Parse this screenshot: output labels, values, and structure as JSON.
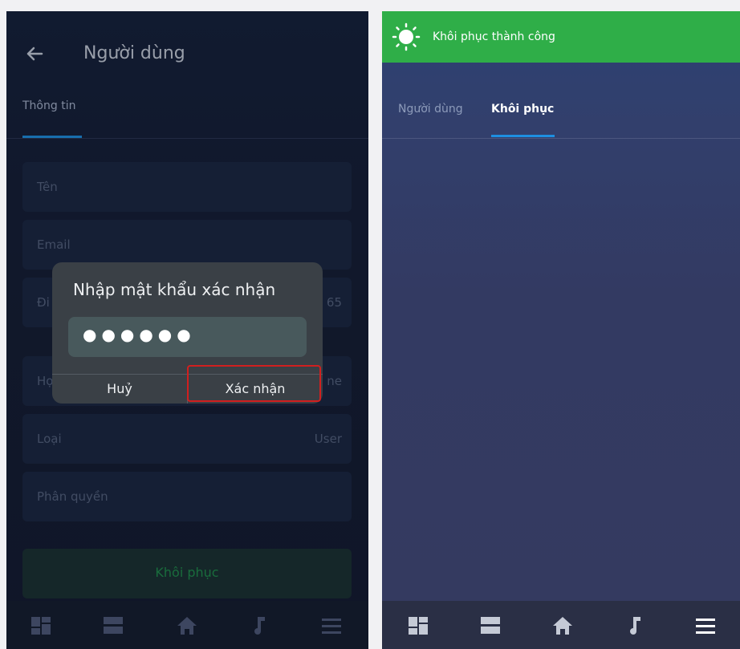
{
  "left": {
    "header_title": "Người dùng",
    "tab_info": "Thông tin",
    "fields": [
      {
        "label": "Tên",
        "value": ""
      },
      {
        "label": "Email",
        "value": ""
      },
      {
        "label": "Đi",
        "value": "65"
      },
      {
        "label": "Họ",
        "value": "ne"
      },
      {
        "label": "Loại",
        "value": "User"
      },
      {
        "label": "Phân quyền",
        "value": ""
      }
    ],
    "restore_button": "Khôi phục"
  },
  "dialog": {
    "title": "Nhập mật khẩu xác nhận",
    "password_value": "●●●●●●",
    "cancel_label": "Huỷ",
    "confirm_label": "Xác nhận"
  },
  "right": {
    "toast_text": "Khôi phục thành công",
    "tab_user": "Người dùng",
    "tab_restore": "Khôi phục"
  },
  "nav": {
    "icons": [
      "dashboard-icon",
      "list-icon",
      "home-icon",
      "music-icon",
      "menu-icon"
    ]
  },
  "colors": {
    "accent_tab": "#1e8fe0",
    "toast_green": "#2fae48",
    "highlight_red": "#d11f1f"
  }
}
